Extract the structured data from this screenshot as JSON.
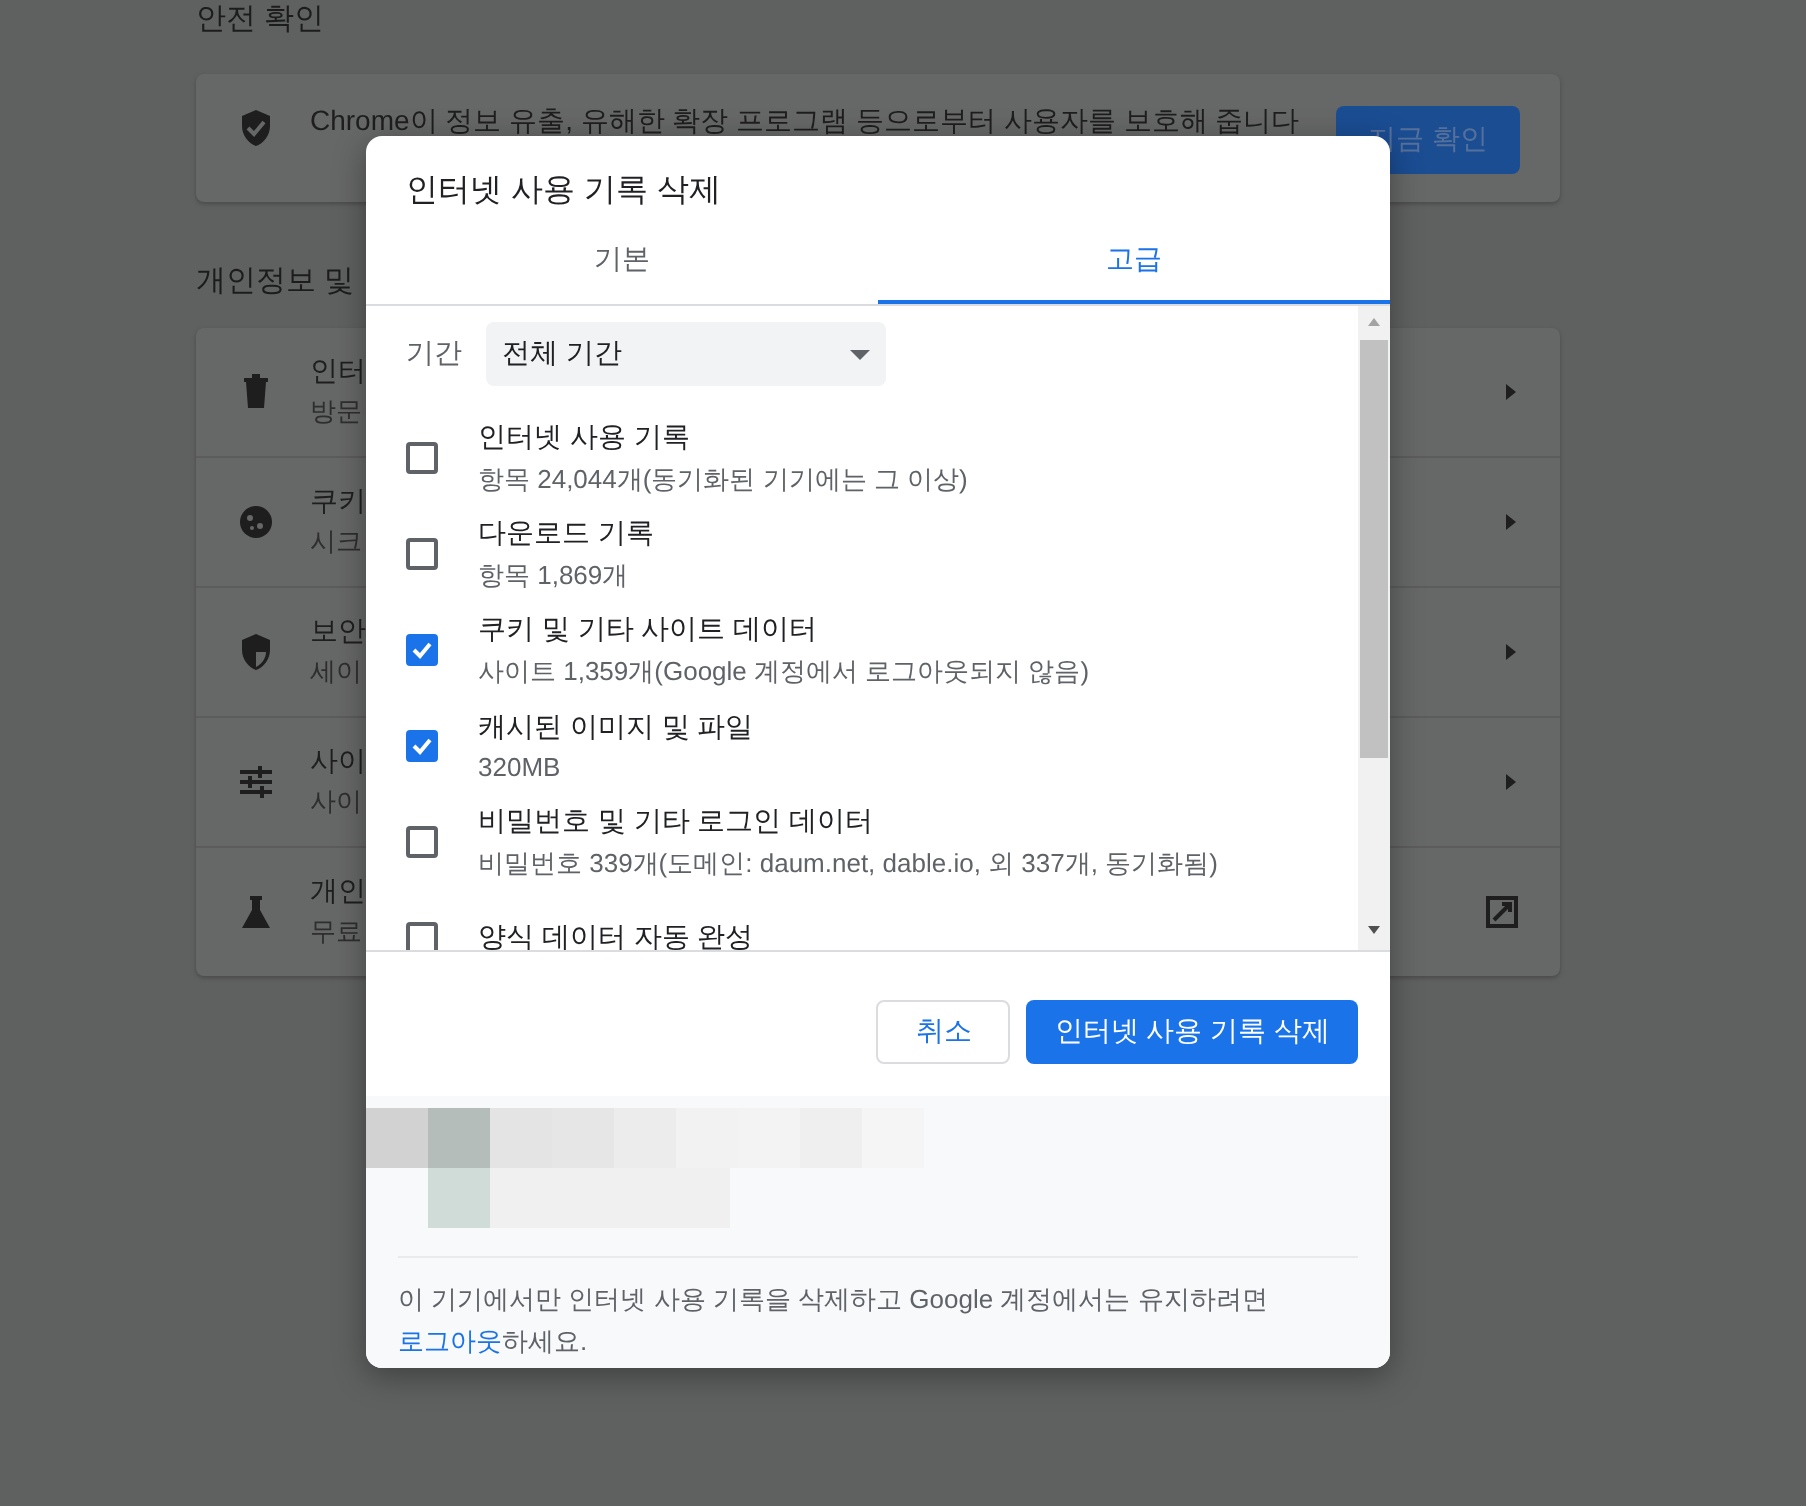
{
  "page": {
    "sections": [
      {
        "heading": "안전 확인",
        "rows": [
          {
            "kind": "action",
            "text": "Chrome이 정보 유출, 유해한 확장 프로그램 등으로부터 사용자를 보호해 줍니다",
            "button": "지금 확인"
          }
        ]
      },
      {
        "heading": "개인정보 및",
        "rows": [
          {
            "kind": "arrow",
            "title": "인터",
            "subtitle": "방문"
          },
          {
            "kind": "arrow",
            "title": "쿠키",
            "subtitle": "시크"
          },
          {
            "kind": "arrow",
            "title": "보안",
            "subtitle": "세이"
          },
          {
            "kind": "arrow",
            "title": "사이",
            "subtitle": "사이"
          },
          {
            "kind": "external",
            "title": "개인",
            "subtitle": "무료"
          }
        ]
      }
    ]
  },
  "dialog": {
    "title": "인터넷 사용 기록 삭제",
    "tabs": [
      {
        "label": "기본",
        "selected": false
      },
      {
        "label": "고급",
        "selected": true
      }
    ],
    "period": {
      "label": "기간",
      "value": "전체 기간"
    },
    "items": [
      {
        "title": "인터넷 사용 기록",
        "detail": "항목 24,044개(동기화된 기기에는 그 이상)",
        "checked": false
      },
      {
        "title": "다운로드 기록",
        "detail": "항목 1,869개",
        "checked": false
      },
      {
        "title": "쿠키 및 기타 사이트 데이터",
        "detail": "사이트 1,359개(Google 계정에서 로그아웃되지 않음)",
        "checked": true
      },
      {
        "title": "캐시된 이미지 및 파일",
        "detail": "320MB",
        "checked": true
      },
      {
        "title": "비밀번호 및 기타 로그인 데이터",
        "detail": "비밀번호 339개(도메인: daum.net, dable.io, 외 337개, 동기화됨)",
        "checked": false
      },
      {
        "title": "양식 데이터 자동 완성",
        "checked": false
      }
    ],
    "buttons": [
      {
        "kind": "secondary",
        "label": "취소"
      },
      {
        "kind": "primary",
        "label": "인터넷 사용 기록 삭제"
      }
    ],
    "footer": {
      "before": "이 기기에서만 인터넷 사용 기록을 삭제하고 Google 계정에서는 유지하려면 ",
      "link": "로그아웃",
      "after": "하세요."
    }
  }
}
